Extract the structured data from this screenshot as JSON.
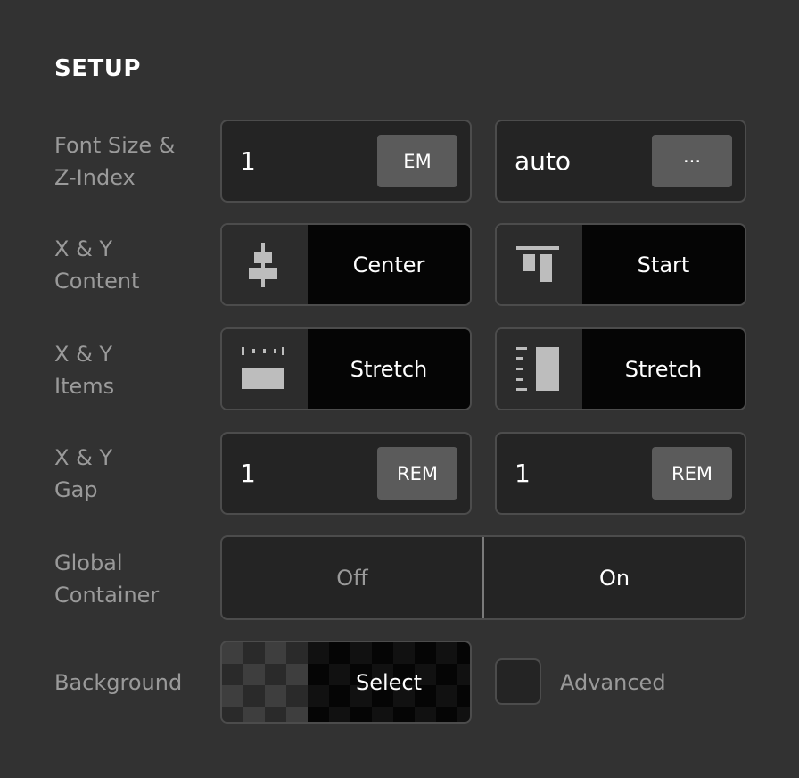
{
  "section": {
    "title": "SETUP"
  },
  "font_size": {
    "label": "Font Size &\nZ-Index",
    "value": "1",
    "unit": "EM",
    "z_value": "auto",
    "z_more": "···"
  },
  "content": {
    "label": "X & Y\nContent",
    "x_value": "Center",
    "y_value": "Start"
  },
  "items": {
    "label": "X & Y\nItems",
    "x_value": "Stretch",
    "y_value": "Stretch"
  },
  "gap": {
    "label": "X & Y\nGap",
    "x_value": "1",
    "x_unit": "REM",
    "y_value": "1",
    "y_unit": "REM"
  },
  "global_container": {
    "label": "Global\nContainer",
    "off_label": "Off",
    "on_label": "On",
    "selected": "On"
  },
  "background": {
    "label": "Background",
    "select_label": "Select",
    "advanced_label": "Advanced",
    "advanced_checked": false
  },
  "colors": {
    "panel_bg": "#323232",
    "field_bg": "#242424",
    "segment_bg": "#050505",
    "unit_button_bg": "#5b5b5b",
    "label_text": "#9a9a9a",
    "value_text": "#ffffff"
  },
  "icons": {
    "content_x": "align-center-vertical-icon",
    "content_y": "align-top-icon",
    "items_x": "stretch-horizontal-icon",
    "items_y": "stretch-vertical-icon"
  }
}
